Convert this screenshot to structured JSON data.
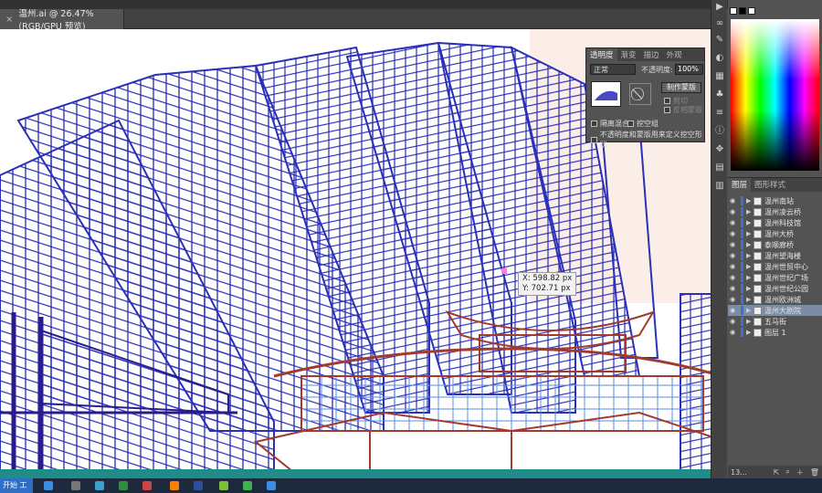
{
  "document_tab": {
    "title": "温州.ai @ 26.47% (RGB/GPU 预览)",
    "close": "×"
  },
  "coord_tooltip": {
    "x_text": "X: 598.82 px",
    "y_text": "Y: 702.71 px"
  },
  "transparency_panel": {
    "tabs": [
      "透明度",
      "渐变",
      "描边",
      "外观"
    ],
    "blend_mode": "正常",
    "opacity_label": "不透明度:",
    "opacity_value": "100%",
    "make_mask_button": "制作蒙版",
    "clip_label": "剪切",
    "invert_label": "反相蒙版",
    "isolate_blending": "隔离混合",
    "knockout_group": "挖空组",
    "opacity_mask_define": "不透明度和蒙版用来定义挖空形状"
  },
  "layers_panel": {
    "tabs": [
      "图层",
      "图形样式"
    ],
    "layers": [
      {
        "name": "温州南站",
        "selected": false
      },
      {
        "name": "温州凌云桥",
        "selected": false
      },
      {
        "name": "温州科技馆",
        "selected": false
      },
      {
        "name": "温州大桥",
        "selected": false
      },
      {
        "name": "泰顺廊桥",
        "selected": false
      },
      {
        "name": "温州望海楼",
        "selected": false
      },
      {
        "name": "温州世贸中心",
        "selected": false
      },
      {
        "name": "温州世纪广场",
        "selected": false
      },
      {
        "name": "温州世纪公园",
        "selected": false
      },
      {
        "name": "温州欧洲城",
        "selected": false
      },
      {
        "name": "温州大剧院",
        "selected": true
      },
      {
        "name": "五马街",
        "selected": false
      },
      {
        "name": "图层 1",
        "selected": false
      }
    ],
    "footer_count": "13..."
  },
  "taskbar": {
    "start_label": "开始 工"
  },
  "colors": {
    "stroke_blue": "#2a30b8",
    "stroke_red": "#a33a2e",
    "selection": "#3b6fd6",
    "ui_dark": "#535353"
  }
}
